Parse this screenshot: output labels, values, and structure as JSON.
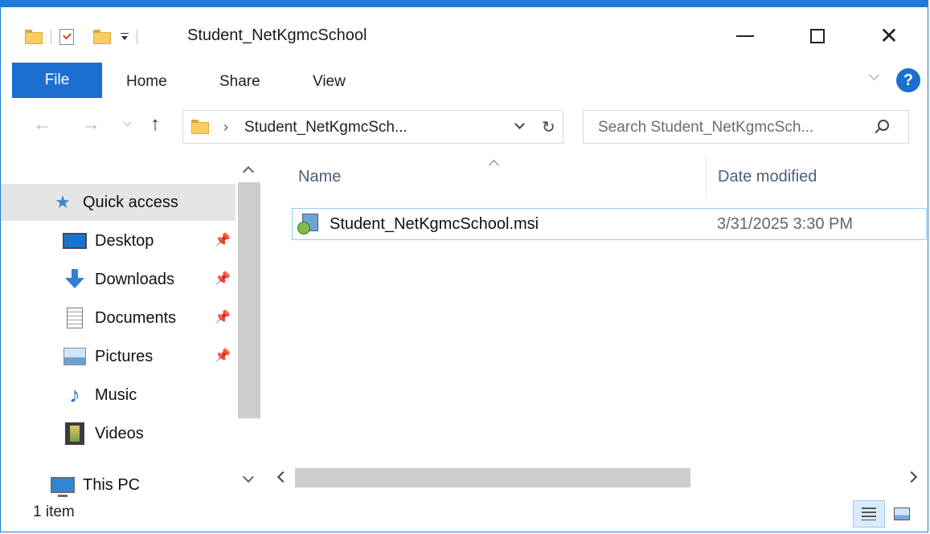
{
  "window": {
    "title": "Student_NetKgmcSchool"
  },
  "ribbon": {
    "file": "File",
    "tabs": [
      "Home",
      "Share",
      "View"
    ],
    "help": "?"
  },
  "navigation": {
    "breadcrumb": "Student_NetKgmcSch...",
    "search_placeholder": "Search Student_NetKgmcSch..."
  },
  "sidebar": {
    "items": [
      {
        "label": "Quick access",
        "icon": "star-icon",
        "selected": true,
        "pinned": false
      },
      {
        "label": "Desktop",
        "icon": "desktop-icon",
        "pinned": true
      },
      {
        "label": "Downloads",
        "icon": "downloads-icon",
        "pinned": true
      },
      {
        "label": "Documents",
        "icon": "documents-icon",
        "pinned": true
      },
      {
        "label": "Pictures",
        "icon": "pictures-icon",
        "pinned": true
      },
      {
        "label": "Music",
        "icon": "music-icon",
        "pinned": false
      },
      {
        "label": "Videos",
        "icon": "videos-icon",
        "pinned": false
      },
      {
        "label": "This PC",
        "icon": "this-pc-icon",
        "pinned": false
      }
    ]
  },
  "content": {
    "columns": [
      "Name",
      "Date modified"
    ],
    "files": [
      {
        "name": "Student_NetKgmcSchool.msi",
        "date_modified": "3/31/2025 3:30 PM",
        "icon": "msi-installer-icon"
      }
    ]
  },
  "status": {
    "item_count": "1 item"
  },
  "colors": {
    "accent": "#1a6fd0",
    "selection_border": "#99c9f3",
    "sidebar_selected": "#e5e5e5"
  }
}
